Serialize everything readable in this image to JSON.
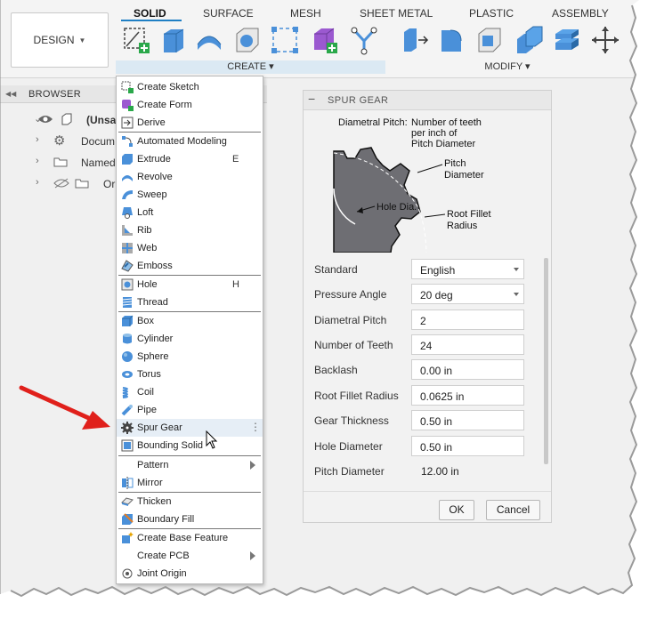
{
  "toolbar": {
    "design_label": "DESIGN",
    "tabs": [
      "SOLID",
      "SURFACE",
      "MESH",
      "SHEET METAL",
      "PLASTIC",
      "ASSEMBLY"
    ],
    "create_label": "CREATE ▾",
    "modify_label": "MODIFY ▾"
  },
  "browser": {
    "header": "BROWSER",
    "rows": [
      "(Unsa",
      "Docum",
      "Named",
      "Or"
    ]
  },
  "create_menu": {
    "items": [
      "Create Sketch",
      "Create Form",
      "Derive",
      "Automated Modeling",
      "Extrude",
      "Revolve",
      "Sweep",
      "Loft",
      "Rib",
      "Web",
      "Emboss",
      "Hole",
      "Thread",
      "Box",
      "Cylinder",
      "Sphere",
      "Torus",
      "Coil",
      "Pipe",
      "Spur Gear",
      "Bounding Solid",
      "Pattern",
      "Mirror",
      "Thicken",
      "Boundary Fill",
      "Create Base Feature",
      "Create PCB",
      "Joint Origin"
    ],
    "shortcuts": {
      "extrude": "E",
      "hole": "H"
    },
    "highlighted": "Spur Gear"
  },
  "panel": {
    "title": "SPUR GEAR",
    "diagram": {
      "diametral_pitch_label": "Diametral Pitch:",
      "diametral_pitch_desc": [
        "Number of teeth",
        "per inch of",
        "Pitch Diameter"
      ],
      "pitch_diameter": [
        "Pitch",
        "Diameter"
      ],
      "hole_dia": "Hole Dia.",
      "root_fillet": [
        "Root Fillet",
        "Radius"
      ]
    },
    "fields": {
      "standard": {
        "label": "Standard",
        "value": "English"
      },
      "pressure_angle": {
        "label": "Pressure Angle",
        "value": "20 deg"
      },
      "diametral_pitch": {
        "label": "Diametral Pitch",
        "value": "2"
      },
      "number_of_teeth": {
        "label": "Number of Teeth",
        "value": "24"
      },
      "backlash": {
        "label": "Backlash",
        "value": "0.00 in"
      },
      "root_fillet_radius": {
        "label": "Root Fillet Radius",
        "value": "0.0625 in"
      },
      "gear_thickness": {
        "label": "Gear Thickness",
        "value": "0.50 in"
      },
      "hole_diameter": {
        "label": "Hole Diameter",
        "value": "0.50 in"
      },
      "pitch_diameter": {
        "label": "Pitch Diameter",
        "value": "12.00 in"
      }
    },
    "ok_label": "OK",
    "cancel_label": "Cancel"
  },
  "colors": {
    "accent_blue": "#1f7fc4",
    "icon_blue": "#4a90d9",
    "form_purple": "#9b59d0",
    "add_green": "#2aa84a",
    "arrow_red": "#e0201b",
    "gear_gray": "#6e6e73"
  }
}
